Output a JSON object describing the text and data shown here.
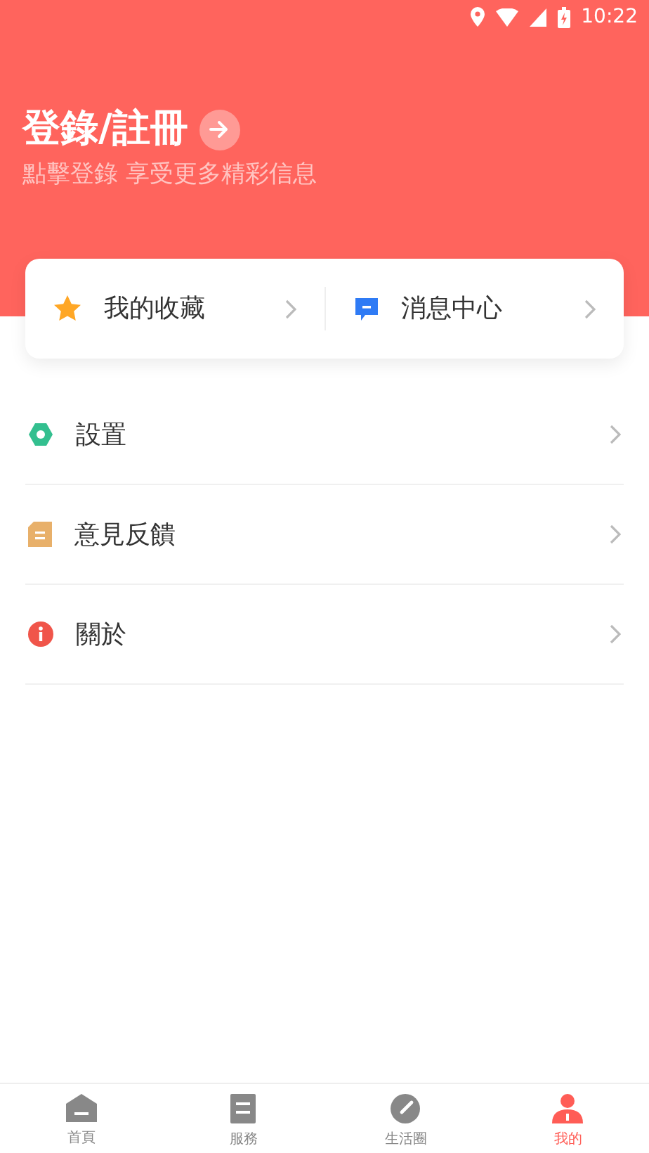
{
  "status_bar": {
    "time": "10:22"
  },
  "header": {
    "title": "登錄/註冊",
    "subtitle": "點擊登錄 享受更多精彩信息"
  },
  "quick_links": [
    {
      "label": "我的收藏"
    },
    {
      "label": "消息中心"
    }
  ],
  "menu": [
    {
      "label": "設置"
    },
    {
      "label": "意見反饋"
    },
    {
      "label": "關於"
    }
  ],
  "tab_bar": [
    {
      "label": "首頁",
      "selected": false
    },
    {
      "label": "服務",
      "selected": false
    },
    {
      "label": "生活圈",
      "selected": false
    },
    {
      "label": "我的",
      "selected": true
    }
  ]
}
